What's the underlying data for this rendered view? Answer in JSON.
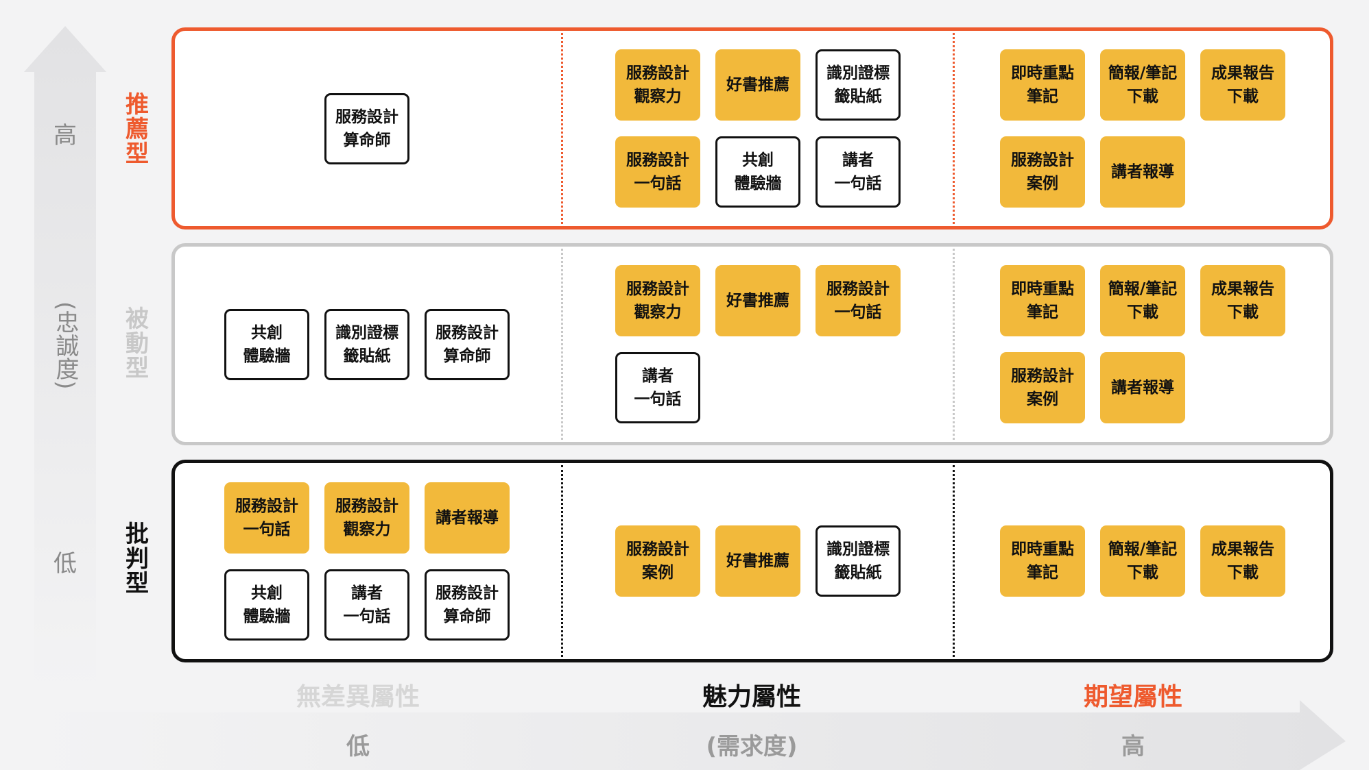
{
  "colors": {
    "recommend": "#ee5a2e",
    "passive": "#c8c8c8",
    "critical": "#111111",
    "card_fill": "#f2b93b",
    "indifferent_title": "#d6d6d6",
    "attractive_title": "#111111",
    "expected_title": "#ee5a2e"
  },
  "y_axis": {
    "high": "高",
    "mid": "(忠誠度)",
    "low": "低"
  },
  "rows": [
    {
      "label": "推薦型",
      "color": "#ee5a2e",
      "indifferent": [
        {
          "text": "服務設計\n算命師",
          "style": "outlined"
        }
      ],
      "attractive": [
        {
          "text": "服務設計\n觀察力",
          "style": "filled"
        },
        {
          "text": "好書推薦",
          "style": "filled"
        },
        {
          "text": "識別證標\n籤貼紙",
          "style": "outlined"
        },
        {
          "text": "服務設計\n一句話",
          "style": "filled"
        },
        {
          "text": "共創\n體驗牆",
          "style": "outlined"
        },
        {
          "text": "講者\n一句話",
          "style": "outlined"
        }
      ],
      "expected": [
        {
          "text": "即時重點\n筆記",
          "style": "filled"
        },
        {
          "text": "簡報/筆記\n下載",
          "style": "filled"
        },
        {
          "text": "成果報告\n下載",
          "style": "filled"
        },
        {
          "text": "服務設計\n案例",
          "style": "filled"
        },
        {
          "text": "講者報導",
          "style": "filled"
        }
      ]
    },
    {
      "label": "被動型",
      "color": "#c8c8c8",
      "indifferent": [
        {
          "text": "共創\n體驗牆",
          "style": "outlined"
        },
        {
          "text": "識別證標\n籤貼紙",
          "style": "outlined"
        },
        {
          "text": "服務設計\n算命師",
          "style": "outlined"
        }
      ],
      "attractive": [
        {
          "text": "服務設計\n觀察力",
          "style": "filled"
        },
        {
          "text": "好書推薦",
          "style": "filled"
        },
        {
          "text": "服務設計\n一句話",
          "style": "filled"
        },
        {
          "text": "講者\n一句話",
          "style": "outlined"
        }
      ],
      "expected": [
        {
          "text": "即時重點\n筆記",
          "style": "filled"
        },
        {
          "text": "簡報/筆記\n下載",
          "style": "filled"
        },
        {
          "text": "成果報告\n下載",
          "style": "filled"
        },
        {
          "text": "服務設計\n案例",
          "style": "filled"
        },
        {
          "text": "講者報導",
          "style": "filled"
        }
      ]
    },
    {
      "label": "批判型",
      "color": "#111111",
      "indifferent": [
        {
          "text": "服務設計\n一句話",
          "style": "filled"
        },
        {
          "text": "服務設計\n觀察力",
          "style": "filled"
        },
        {
          "text": "講者報導",
          "style": "filled"
        },
        {
          "text": "共創\n體驗牆",
          "style": "outlined"
        },
        {
          "text": "講者\n一句話",
          "style": "outlined"
        },
        {
          "text": "服務設計\n算命師",
          "style": "outlined"
        }
      ],
      "attractive": [
        {
          "text": "服務設計\n案例",
          "style": "filled"
        },
        {
          "text": "好書推薦",
          "style": "filled"
        },
        {
          "text": "識別證標\n籤貼紙",
          "style": "outlined"
        }
      ],
      "expected": [
        {
          "text": "即時重點\n筆記",
          "style": "filled"
        },
        {
          "text": "簡報/筆記\n下載",
          "style": "filled"
        },
        {
          "text": "成果報告\n下載",
          "style": "filled"
        }
      ]
    }
  ],
  "columns": {
    "indifferent": "無差異屬性",
    "attractive": "魅力屬性",
    "expected": "期望屬性"
  },
  "x_axis": {
    "low": "低",
    "mid": "(需求度)",
    "high": "高"
  }
}
